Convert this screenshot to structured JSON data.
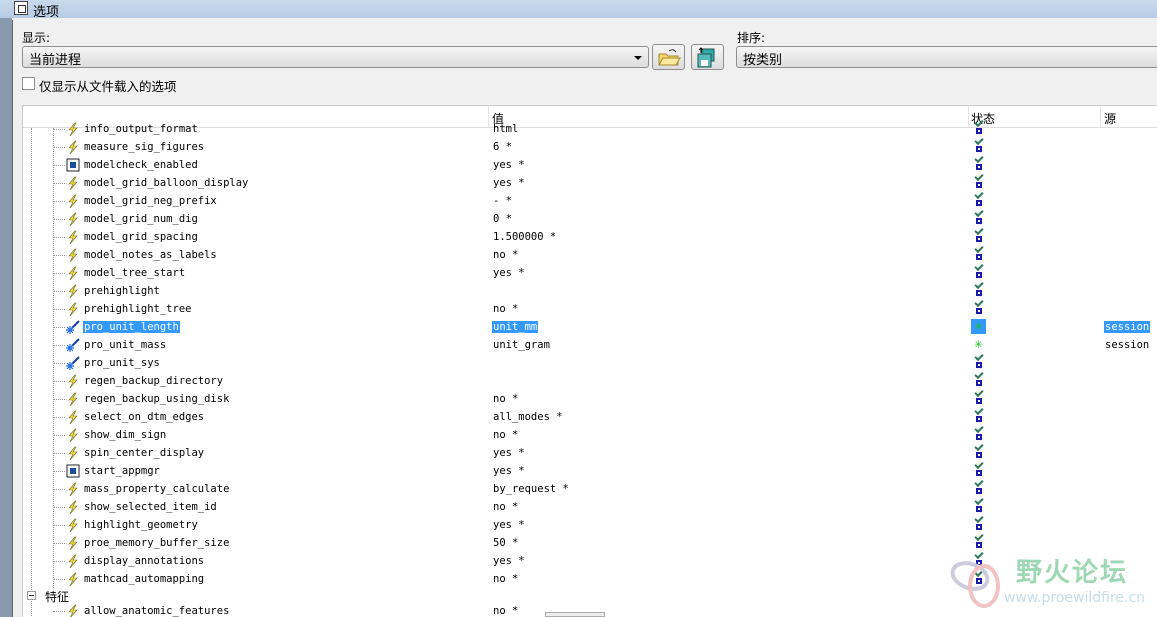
{
  "window": {
    "title": "选项"
  },
  "display": {
    "label": "显示:",
    "value": "当前进程"
  },
  "sort": {
    "label": "排序:",
    "value": "按类别"
  },
  "buttons": {
    "open": "open-folder-icon",
    "save": "save-icon"
  },
  "filter_checkbox": {
    "label": "仅显示从文件载入的选项",
    "checked": false
  },
  "columns": {
    "name": "",
    "value": "值",
    "status": "状态",
    "source": "源"
  },
  "rows": [
    {
      "name": "info_output_format",
      "value": "html",
      "icon": "lightning",
      "status": "ok"
    },
    {
      "name": "measure_sig_figures",
      "value": "6 *",
      "icon": "lightning",
      "status": "ok"
    },
    {
      "name": "modelcheck_enabled",
      "value": "yes *",
      "icon": "box",
      "status": "ok"
    },
    {
      "name": "model_grid_balloon_display",
      "value": "yes *",
      "icon": "lightning",
      "status": "ok"
    },
    {
      "name": "model_grid_neg_prefix",
      "value": "- *",
      "icon": "lightning",
      "status": "ok"
    },
    {
      "name": "model_grid_num_dig",
      "value": "0 *",
      "icon": "lightning",
      "status": "ok"
    },
    {
      "name": "model_grid_spacing",
      "value": "1.500000 *",
      "icon": "lightning",
      "status": "ok"
    },
    {
      "name": "model_notes_as_labels",
      "value": "no *",
      "icon": "lightning",
      "status": "ok"
    },
    {
      "name": "model_tree_start",
      "value": "yes *",
      "icon": "lightning",
      "status": "ok"
    },
    {
      "name": "prehighlight",
      "value": "",
      "icon": "lightning",
      "status": "ok"
    },
    {
      "name": "prehighlight_tree",
      "value": "no *",
      "icon": "lightning",
      "status": "ok"
    },
    {
      "name": "pro_unit_length",
      "value": "unit_mm",
      "icon": "wand",
      "status": "changed",
      "source": "session",
      "selected": true
    },
    {
      "name": "pro_unit_mass",
      "value": "unit_gram",
      "icon": "wand",
      "status": "changed",
      "source": "session"
    },
    {
      "name": "pro_unit_sys",
      "value": "",
      "icon": "wand",
      "status": "ok"
    },
    {
      "name": "regen_backup_directory",
      "value": "",
      "icon": "lightning",
      "status": "ok"
    },
    {
      "name": "regen_backup_using_disk",
      "value": "no *",
      "icon": "lightning",
      "status": "ok"
    },
    {
      "name": "select_on_dtm_edges",
      "value": "all_modes *",
      "icon": "lightning",
      "status": "ok"
    },
    {
      "name": "show_dim_sign",
      "value": "no *",
      "icon": "lightning",
      "status": "ok"
    },
    {
      "name": "spin_center_display",
      "value": "yes *",
      "icon": "lightning",
      "status": "ok"
    },
    {
      "name": "start_appmgr",
      "value": "yes *",
      "icon": "box",
      "status": "ok"
    },
    {
      "name": "mass_property_calculate",
      "value": "by_request *",
      "icon": "lightning",
      "status": "ok"
    },
    {
      "name": "show_selected_item_id",
      "value": "no *",
      "icon": "lightning",
      "status": "ok"
    },
    {
      "name": "highlight_geometry",
      "value": "yes *",
      "icon": "lightning",
      "status": "ok"
    },
    {
      "name": "proe_memory_buffer_size",
      "value": "50 *",
      "icon": "lightning",
      "status": "ok"
    },
    {
      "name": "display_annotations",
      "value": "yes *",
      "icon": "lightning",
      "status": "ok"
    },
    {
      "name": "mathcad_automapping",
      "value": "no *",
      "icon": "lightning",
      "status": "ok"
    }
  ],
  "group": {
    "label": "特征"
  },
  "after_group": {
    "name": "allow_anatomic_features",
    "value": "no *"
  },
  "watermark": {
    "text": "野火论坛",
    "url": "www.proewildfire.cn"
  }
}
